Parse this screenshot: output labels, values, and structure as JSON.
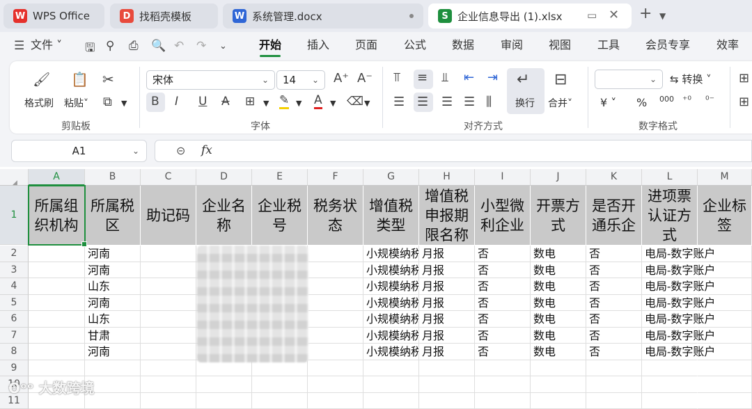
{
  "tabs": [
    {
      "label": "WPS Office",
      "icon": "wps-logo-icon"
    },
    {
      "label": "找稻壳模板",
      "icon": "docer-icon"
    },
    {
      "label": "系统管理.docx",
      "icon": "word-doc-icon"
    },
    {
      "label": "企业信息导出 (1).xlsx",
      "icon": "sheet-doc-icon"
    }
  ],
  "menu": {
    "file": "文件",
    "tabs": [
      "开始",
      "插入",
      "页面",
      "公式",
      "数据",
      "审阅",
      "视图",
      "工具",
      "会员专享",
      "效率"
    ],
    "active": "开始"
  },
  "ribbon": {
    "format_painter": "格式刷",
    "paste": "粘贴",
    "group_clipboard": "剪贴板",
    "font_name": "宋体",
    "font_size": "14",
    "group_font": "字体",
    "wrap": "换行",
    "merge": "合并",
    "group_align": "对齐方式",
    "convert": "转换",
    "group_number": "数字格式",
    "currency": "¥",
    "percent": "%",
    "thousands": "000"
  },
  "formula_bar": {
    "cell_ref": "A1",
    "fx": "fx",
    "value": ""
  },
  "grid": {
    "columns": [
      "A",
      "B",
      "C",
      "D",
      "E",
      "F",
      "G",
      "H",
      "I",
      "J",
      "K",
      "L",
      "M"
    ],
    "selected_column": "A",
    "headers": [
      "所属组织机构",
      "所属税区",
      "助记码",
      "企业名称",
      "企业税号",
      "税务状态",
      "增值税类型",
      "增值税申报期限名称",
      "小型微利企业",
      "开票方式",
      "是否开通乐企",
      "进项票认证方式",
      "企业标签"
    ],
    "rows": [
      {
        "num": "2",
        "B": "河南",
        "G": "小规模纳税人",
        "H": "月报",
        "I": "否",
        "J": "数电",
        "K": "否",
        "L": "电局-数字账户"
      },
      {
        "num": "3",
        "B": "河南",
        "G": "小规模纳税人",
        "H": "月报",
        "I": "否",
        "J": "数电",
        "K": "否",
        "L": "电局-数字账户"
      },
      {
        "num": "4",
        "B": "山东",
        "G": "小规模纳税人",
        "H": "月报",
        "I": "否",
        "J": "数电",
        "K": "否",
        "L": "电局-数字账户"
      },
      {
        "num": "5",
        "B": "河南",
        "G": "小规模纳税人",
        "H": "月报",
        "I": "否",
        "J": "数电",
        "K": "否",
        "L": "电局-数字账户"
      },
      {
        "num": "6",
        "B": "山东",
        "G": "小规模纳税人",
        "H": "月报",
        "I": "否",
        "J": "数电",
        "K": "否",
        "L": "电局-数字账户"
      },
      {
        "num": "7",
        "B": "甘肃",
        "G": "小规模纳税人",
        "H": "月报",
        "I": "否",
        "J": "数电",
        "K": "否",
        "L": "电局-数字账户"
      },
      {
        "num": "8",
        "B": "河南",
        "G": "小规模纳税人",
        "H": "月报",
        "I": "否",
        "J": "数电",
        "K": "否",
        "L": "电局-数字账户"
      }
    ],
    "empty_rows": [
      "9",
      "10",
      "11"
    ],
    "header_row_num": "1"
  },
  "watermark": "大数跨境",
  "colors": {
    "accent": "#1e8f3e",
    "header_fill": "#c9c9c9"
  }
}
